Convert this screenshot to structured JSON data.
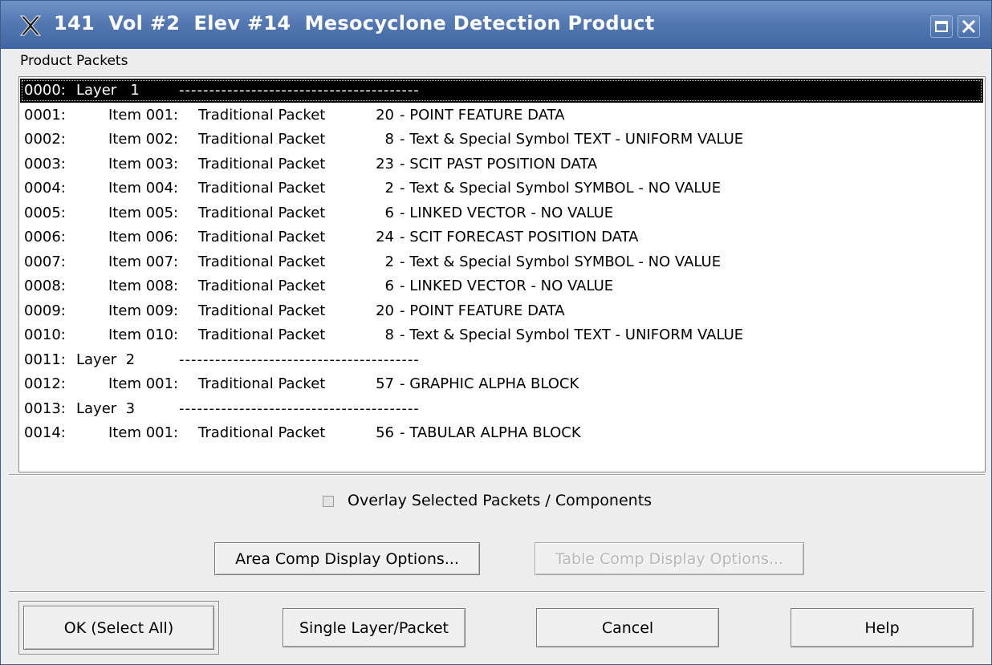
{
  "window": {
    "title": "141  Vol #2  Elev #14  Mesocyclone Detection Product",
    "app_icon": "x-icon",
    "controls": [
      "maximize-icon",
      "close-icon"
    ]
  },
  "section_label": "Product Packets",
  "packets": [
    {
      "num": "0000:",
      "layer": "Layer   1",
      "dashes": "----------------------------------------",
      "selected": true
    },
    {
      "num": "0001:",
      "item": "Item 001:",
      "type": "Traditional Packet",
      "packet": "20",
      "desc": "- POINT FEATURE DATA"
    },
    {
      "num": "0002:",
      "item": "Item 002:",
      "type": "Traditional Packet",
      "packet": "8",
      "desc": "- Text & Special Symbol TEXT - UNIFORM VALUE"
    },
    {
      "num": "0003:",
      "item": "Item 003:",
      "type": "Traditional Packet",
      "packet": "23",
      "desc": "- SCIT PAST POSITION DATA"
    },
    {
      "num": "0004:",
      "item": "Item 004:",
      "type": "Traditional Packet",
      "packet": "2",
      "desc": "- Text & Special Symbol SYMBOL - NO VALUE"
    },
    {
      "num": "0005:",
      "item": "Item 005:",
      "type": "Traditional Packet",
      "packet": "6",
      "desc": "- LINKED VECTOR - NO VALUE"
    },
    {
      "num": "0006:",
      "item": "Item 006:",
      "type": "Traditional Packet",
      "packet": "24",
      "desc": "- SCIT FORECAST POSITION DATA"
    },
    {
      "num": "0007:",
      "item": "Item 007:",
      "type": "Traditional Packet",
      "packet": "2",
      "desc": "- Text & Special Symbol SYMBOL - NO VALUE"
    },
    {
      "num": "0008:",
      "item": "Item 008:",
      "type": "Traditional Packet",
      "packet": "6",
      "desc": "- LINKED VECTOR - NO VALUE"
    },
    {
      "num": "0009:",
      "item": "Item 009:",
      "type": "Traditional Packet",
      "packet": "20",
      "desc": "- POINT FEATURE DATA"
    },
    {
      "num": "0010:",
      "item": "Item 010:",
      "type": "Traditional Packet",
      "packet": "8",
      "desc": "- Text & Special Symbol TEXT - UNIFORM VALUE"
    },
    {
      "num": "0011:",
      "layer": "Layer  2",
      "dashes": "----------------------------------------"
    },
    {
      "num": "0012:",
      "item": "Item 001:",
      "type": "Traditional Packet",
      "packet": "57",
      "desc": "- GRAPHIC ALPHA BLOCK"
    },
    {
      "num": "0013:",
      "layer": "Layer  3",
      "dashes": "----------------------------------------"
    },
    {
      "num": "0014:",
      "item": "Item 001:",
      "type": "Traditional Packet",
      "packet": "56",
      "desc": "- TABULAR ALPHA BLOCK"
    }
  ],
  "overlay": {
    "label": "Overlay Selected Packets / Components",
    "checked": false
  },
  "options": {
    "area_comp": "Area Comp Display Options...",
    "table_comp": "Table Comp Display Options..."
  },
  "footer": {
    "ok": "OK (Select All)",
    "single": "Single Layer/Packet",
    "cancel": "Cancel",
    "help": "Help"
  },
  "colors": {
    "titlebar": "#5479b2",
    "selection": "#000000",
    "dialog_bg": "#ededed"
  }
}
